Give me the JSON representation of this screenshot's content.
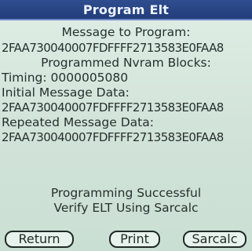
{
  "titlebar": {
    "title": "Program Elt"
  },
  "content": {
    "message_to_program_label": "Message to Program:",
    "message_to_program_value": "2FAA730040007FDFFFF2713583E0FAA8",
    "programmed_blocks_label": "Programmed Nvram Blocks:",
    "timing_label": "Timing: 0000005080",
    "initial_message_label": "Initial Message Data:",
    "initial_message_value": "2FAA730040007FDFFFF2713583E0FAA8",
    "repeated_message_label": "Repeated Message Data:",
    "repeated_message_value": "2FAA730040007FDFFFF2713583E0FAA8",
    "status_line_1": "Programming Successful",
    "status_line_2": "Verify ELT Using Sarcalc"
  },
  "buttons": {
    "return_label": "Return",
    "print_label": "Print",
    "sarcalc_label": "Sarcalc"
  }
}
